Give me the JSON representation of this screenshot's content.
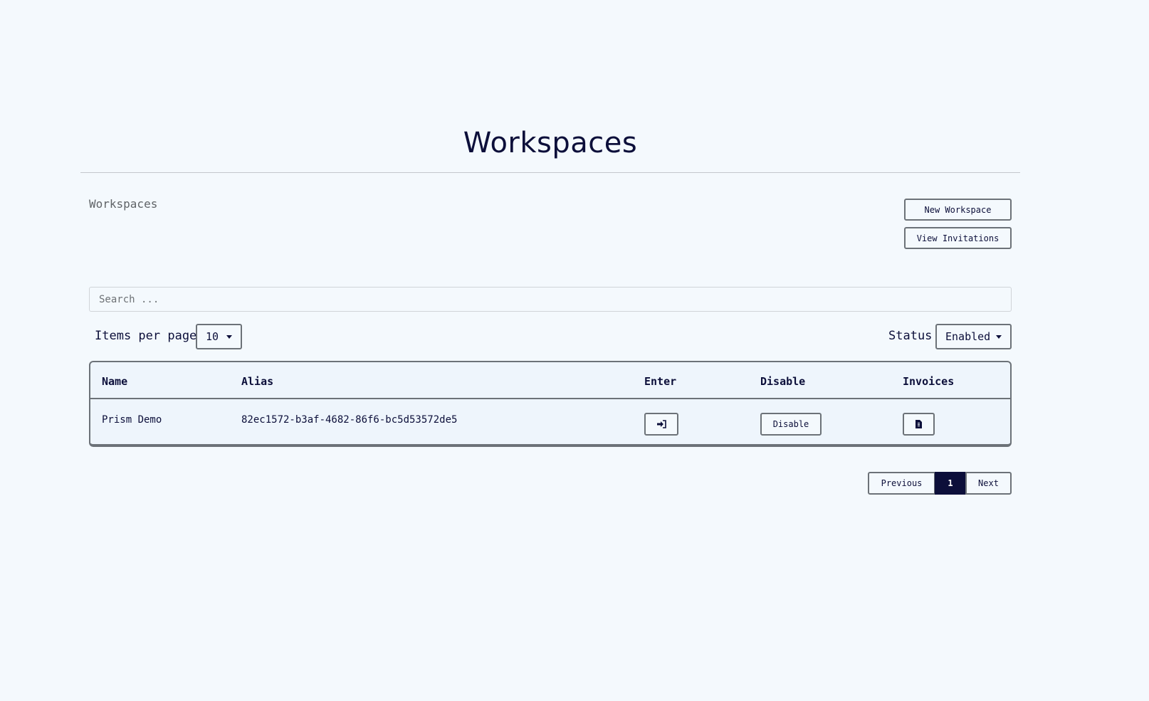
{
  "page": {
    "title": "Workspaces",
    "breadcrumb": "Workspaces"
  },
  "actions": {
    "new_workspace": "New Workspace",
    "view_invitations": "View Invitations"
  },
  "search": {
    "placeholder": "Search ...",
    "value": ""
  },
  "filters": {
    "items_per_page_label": "Items per page",
    "items_per_page_value": "10",
    "status_label": "Status",
    "status_value": "Enabled"
  },
  "table": {
    "columns": [
      "Name",
      "Alias",
      "Enter",
      "Disable",
      "Invoices"
    ],
    "rows": [
      {
        "name": "Prism Demo",
        "alias": "82ec1572-b3af-4682-86f6-bc5d53572de5",
        "enter_icon": "sign-in-icon",
        "disable_label": "Disable",
        "invoices_icon": "invoice-file-icon"
      }
    ]
  },
  "pagination": {
    "previous": "Previous",
    "current_page": "1",
    "next": "Next"
  },
  "colors": {
    "background": "#f4f9fd",
    "primary": "#0c0f3a",
    "border": "#6c7278"
  }
}
